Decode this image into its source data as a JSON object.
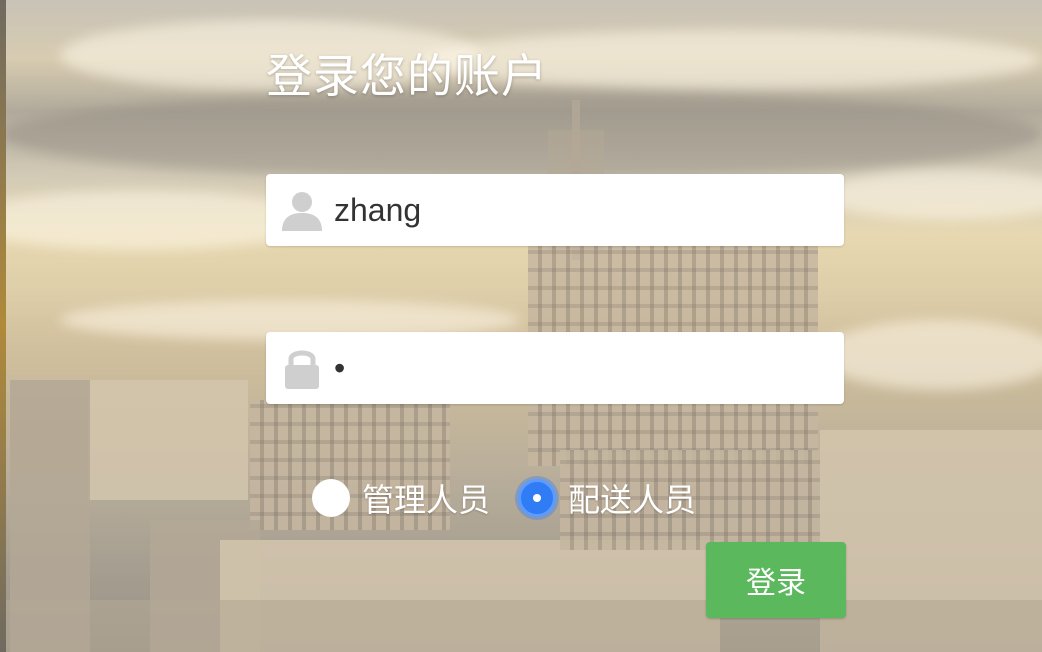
{
  "login": {
    "title": "登录您的账户",
    "username": {
      "value": "zhang",
      "icon": "user-icon"
    },
    "password": {
      "value": "•",
      "icon": "lock-icon"
    },
    "roles": [
      {
        "label": "管理人员",
        "checked": false
      },
      {
        "label": "配送人员",
        "checked": true
      }
    ],
    "submit_label": "登录"
  },
  "colors": {
    "button_green": "#5cb85c",
    "radio_blue": "#2f7cf5",
    "text_white": "#ffffff"
  }
}
